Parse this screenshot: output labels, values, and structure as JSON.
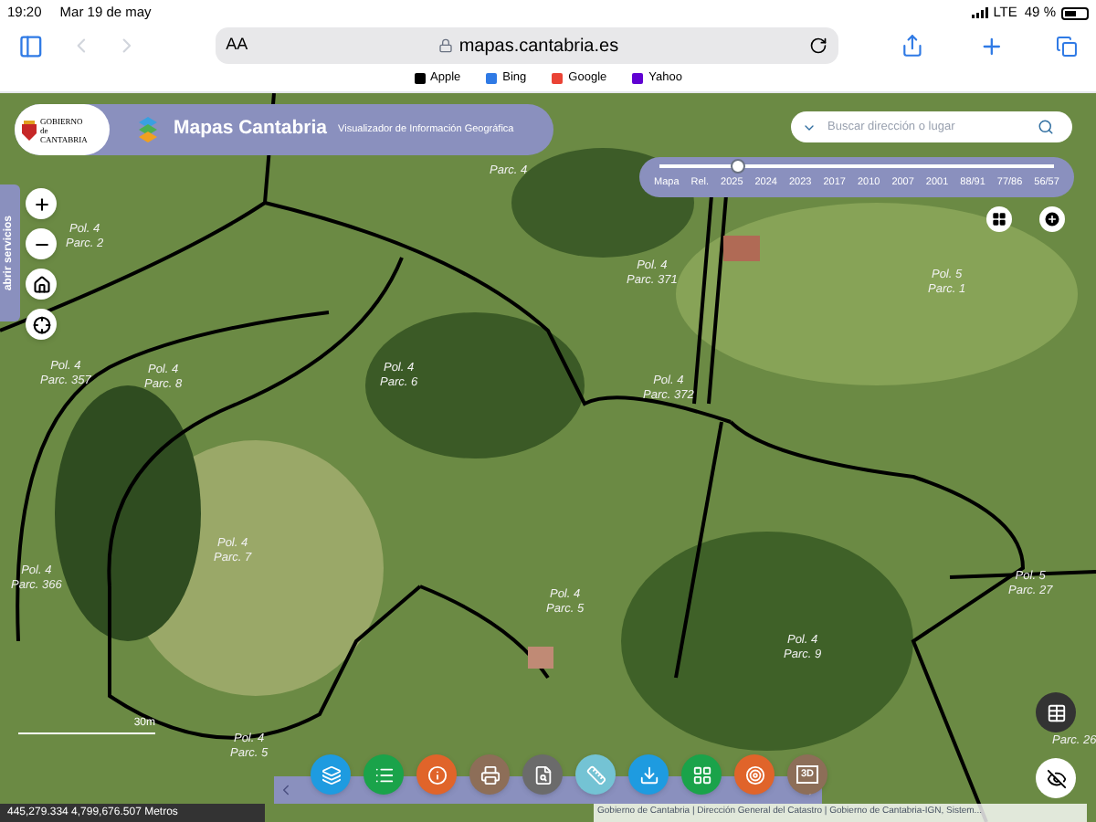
{
  "status_bar": {
    "time": "19:20",
    "date": "Mar 19 de may",
    "network": "LTE",
    "battery": "49 %"
  },
  "browser": {
    "text_size": "AA",
    "url": "mapas.cantabria.es",
    "bookmarks": [
      "Apple",
      "Bing",
      "Google",
      "Yahoo"
    ]
  },
  "header": {
    "logo_top": "GOBIERNO",
    "logo_mid": "de",
    "logo_bottom": "CANTABRIA",
    "title": "Mapas Cantabria",
    "subtitle": "Visualizador de Información Geográfica"
  },
  "search": {
    "placeholder": "Buscar dirección o lugar"
  },
  "timeline": {
    "labels": [
      "Mapa",
      "Rel.",
      "2025",
      "2024",
      "2023",
      "2017",
      "2010",
      "2007",
      "2001",
      "88/91",
      "77/86",
      "56/57"
    ],
    "level": 0.2
  },
  "side_tab": "abrir servicios",
  "parcels": [
    {
      "parc": "Parc. 4"
    },
    {
      "pol": "Pol. 4",
      "parc": "Parc. 2"
    },
    {
      "pol": "Pol. 4",
      "parc": "Parc. 371"
    },
    {
      "pol": "Pol. 5",
      "parc": "Parc. 1"
    },
    {
      "pol": "Pol. 4",
      "parc": "Parc. 357"
    },
    {
      "pol": "Pol. 4",
      "parc": "Parc. 8"
    },
    {
      "pol": "Pol. 4",
      "parc": "Parc. 6"
    },
    {
      "pol": "Pol. 4",
      "parc": "Parc. 372"
    },
    {
      "pol": "Pol. 4",
      "parc": "Parc. 366"
    },
    {
      "pol": "Pol. 4",
      "parc": "Parc. 7"
    },
    {
      "pol": "Pol. 4",
      "parc": "Parc. 5"
    },
    {
      "pol": "Pol. 5",
      "parc": "Parc. 27"
    },
    {
      "pol": "Pol. 4",
      "parc": "Parc. 9"
    },
    {
      "pol": "Pol. 4",
      "parc": "Parc. 5"
    },
    {
      "parc": "Parc. 26"
    }
  ],
  "tools": [
    {
      "kind": "layers",
      "color": "#1e9be0"
    },
    {
      "kind": "list",
      "color": "#1aa34a"
    },
    {
      "kind": "info",
      "color": "#e0642a"
    },
    {
      "kind": "print",
      "color": "#8d6e58"
    },
    {
      "kind": "query",
      "color": "#6b6b6b"
    },
    {
      "kind": "ruler",
      "color": "#74c3d4"
    },
    {
      "kind": "download",
      "color": "#1e9be0"
    },
    {
      "kind": "grid",
      "color": "#1aa34a"
    },
    {
      "kind": "target",
      "color": "#e0642a"
    },
    {
      "kind": "perspective",
      "color": "#8d6e58",
      "label": "3D"
    }
  ],
  "scale": "30m",
  "coordinates": "445,279.334 4,799,676.507 Metros",
  "attribution": "Gobierno de Cantabria | Dirección General del Catastro | Gobierno de Cantabria-IGN, Sistem..."
}
